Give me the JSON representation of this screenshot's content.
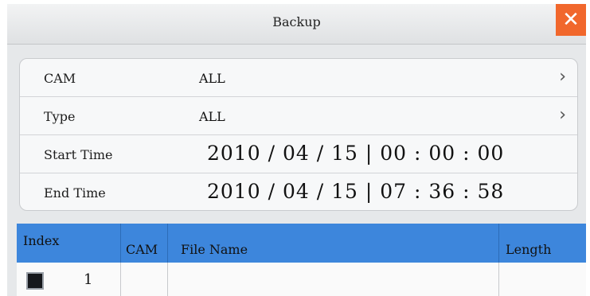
{
  "window": {
    "title": "Backup"
  },
  "close": {
    "label": "✕"
  },
  "form": {
    "cam": {
      "label": "CAM",
      "value": "ALL",
      "chevron": "›"
    },
    "type": {
      "label": "Type",
      "value": "ALL",
      "chevron": "›"
    },
    "start_time": {
      "label": "Start Time",
      "value": "2010 / 04 / 15 | 00 : 00 : 00"
    },
    "end_time": {
      "label": "End Time",
      "value": "2010 / 04 / 15 | 07 : 36 : 58"
    }
  },
  "table": {
    "columns": [
      "Index",
      "CAM",
      "File Name",
      "Length"
    ],
    "rows": [
      {
        "index": "1",
        "cam": "",
        "file_name": "",
        "length": ""
      }
    ]
  },
  "colors": {
    "header_blue": "#3d86dc",
    "close_orange": "#f1672c"
  }
}
